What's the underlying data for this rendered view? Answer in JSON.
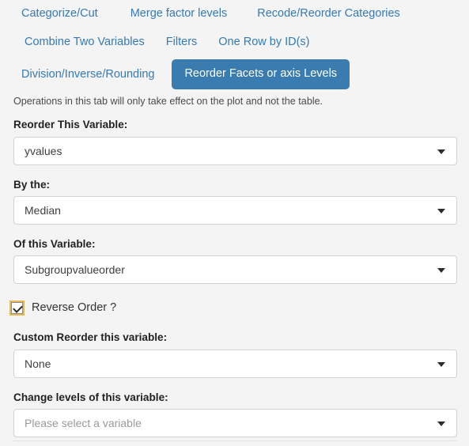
{
  "tabs": {
    "row1": [
      {
        "label": "Categorize/Cut",
        "active": false
      },
      {
        "label": "Merge factor levels",
        "active": false
      },
      {
        "label": "Recode/Reorder Categories",
        "active": false
      }
    ],
    "row2": [
      {
        "label": "Combine Two Variables",
        "active": false
      },
      {
        "label": "Filters",
        "active": false
      },
      {
        "label": "One Row by ID(s)",
        "active": false
      }
    ],
    "row3": [
      {
        "label": "Division/Inverse/Rounding",
        "active": false
      },
      {
        "label": "Reorder Facets or axis Levels",
        "active": true
      }
    ]
  },
  "note": "Operations in this tab will only take effect on the plot and not the table.",
  "form": {
    "reorder_variable": {
      "label": "Reorder This Variable:",
      "value": "yvalues",
      "icon": "chevron-down-icon"
    },
    "by_the": {
      "label": "By the:",
      "value": "Median",
      "icon": "chevron-down-icon"
    },
    "of_this_variable": {
      "label": "Of this Variable:",
      "value": "Subgroupvalueorder",
      "icon": "chevron-down-icon"
    },
    "reverse_order": {
      "label": "Reverse Order ?",
      "checked": true
    },
    "custom_reorder": {
      "label": "Custom Reorder this variable:",
      "value": "None",
      "icon": "chevron-down-icon"
    },
    "change_levels": {
      "label": "Change levels of this variable:",
      "placeholder": "Please select a variable",
      "value": "Please select a variable",
      "icon": "chevron-down-icon"
    }
  },
  "colors": {
    "accent": "#3a7cb0",
    "link": "#337ab7",
    "background": "#f4f4f4",
    "focus_ring": "#e8b852"
  }
}
